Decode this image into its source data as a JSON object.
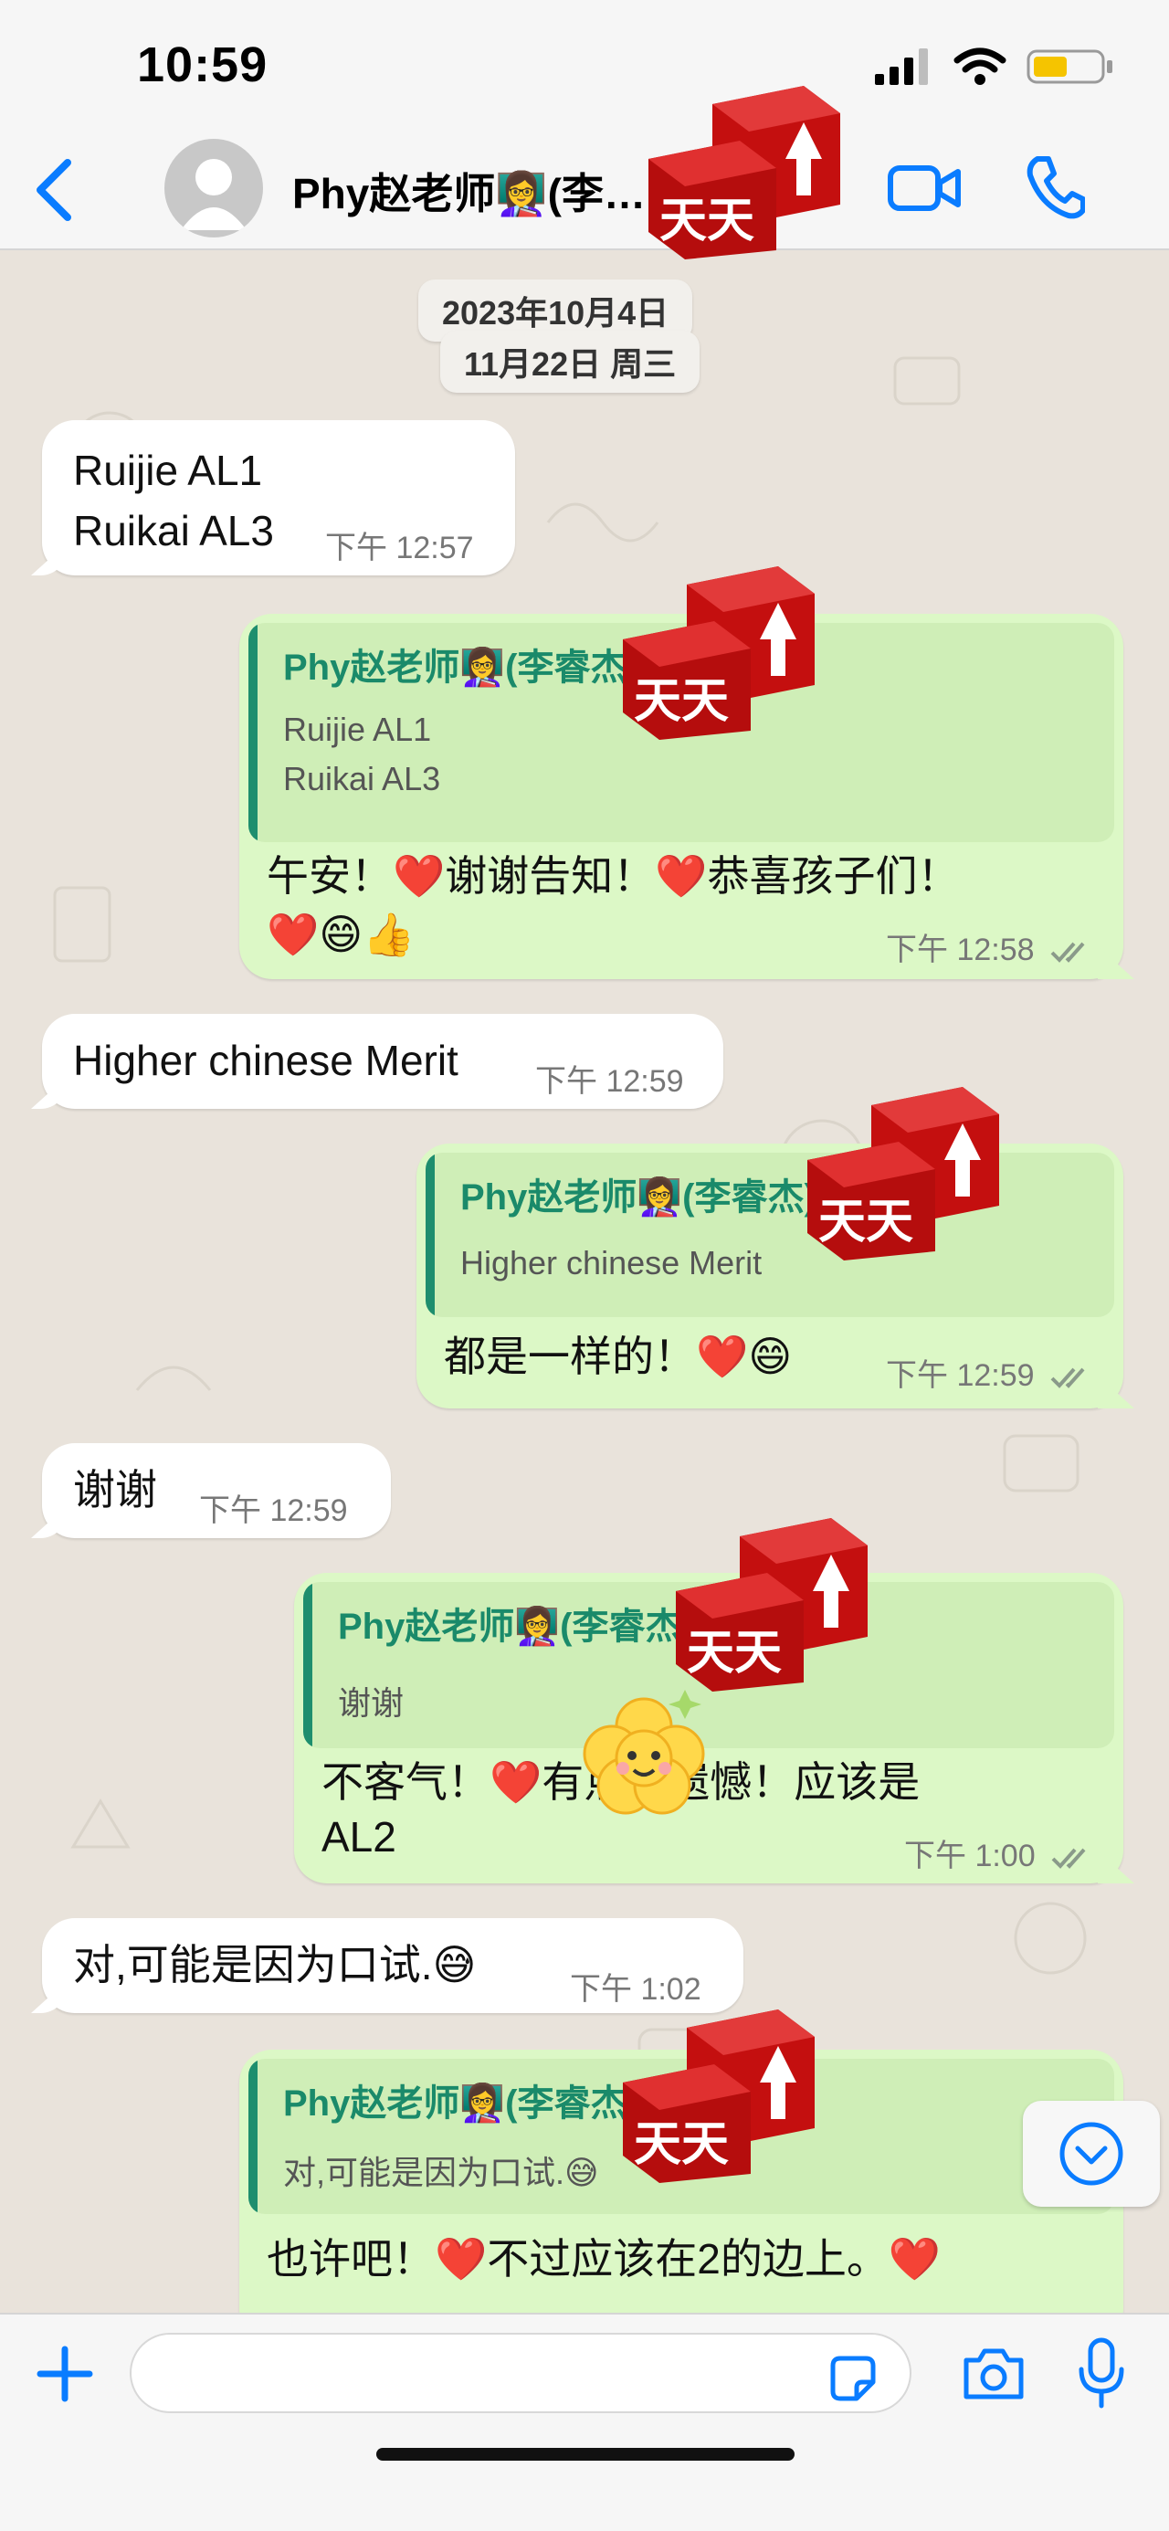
{
  "status_bar": {
    "time": "10:59"
  },
  "header": {
    "contact_name": "Phy赵老师👩‍🏫(李睿杰)",
    "contact_name_visible": "Phy赵老师👩‍🏫(李…"
  },
  "dates": [
    "2023年10月4日",
    "11月22日 周三"
  ],
  "messages": [
    {
      "direction": "in",
      "lines": [
        "Ruijie AL1",
        "Ruikai AL3"
      ],
      "time": "下午 12:57"
    },
    {
      "direction": "out",
      "quote": {
        "name": "Phy赵老师👩‍🏫(李睿杰)",
        "lines": [
          "Ruijie AL1",
          "Ruikai AL3"
        ]
      },
      "lines": [
        "午安！❤️谢谢告知！❤️恭喜孩子们！",
        "❤️😄👍"
      ],
      "time": "下午 12:58"
    },
    {
      "direction": "in",
      "lines": [
        "Higher chinese Merit"
      ],
      "time": "下午 12:59"
    },
    {
      "direction": "out",
      "quote": {
        "name": "Phy赵老师👩‍🏫(李睿杰)",
        "lines": [
          "Higher chinese Merit"
        ]
      },
      "lines": [
        "都是一样的！❤️😄"
      ],
      "time": "下午 12:59"
    },
    {
      "direction": "in",
      "lines": [
        "谢谢"
      ],
      "time": "下午 12:59"
    },
    {
      "direction": "out",
      "quote": {
        "name": "Phy赵老师👩‍🏫(李睿杰)",
        "lines": [
          "谢谢"
        ]
      },
      "lines": [
        "不客气！❤️有点儿遗憾！应该是",
        "AL2"
      ],
      "time": "下午 1:00"
    },
    {
      "direction": "in",
      "lines": [
        "对,可能是因为口试.😅"
      ],
      "time": "下午 1:02"
    },
    {
      "direction": "out",
      "quote": {
        "name": "Phy赵老师👩‍🏫(李睿杰)",
        "lines": [
          "对,可能是因为口试.😅"
        ]
      },
      "lines": [
        "也许吧！❤️不过应该在2的边上。❤️"
      ],
      "time": ""
    }
  ],
  "watermark_text": "天天",
  "composer": {
    "placeholder": ""
  },
  "colors": {
    "accent": "#0a7cff",
    "outgoing_bubble": "#dcf8c6",
    "incoming_bubble": "#ffffff",
    "quote_name": "#1a8a6a",
    "watermark_red": "#d11a1a"
  },
  "icons": {
    "back": "chevron-left-icon",
    "video": "video-camera-icon",
    "call": "phone-icon",
    "plus": "plus-icon",
    "sticker": "sticker-icon",
    "camera": "camera-icon",
    "mic": "microphone-icon",
    "scroll_down": "chevron-down-circle-icon",
    "read_receipt": "double-check-icon"
  }
}
